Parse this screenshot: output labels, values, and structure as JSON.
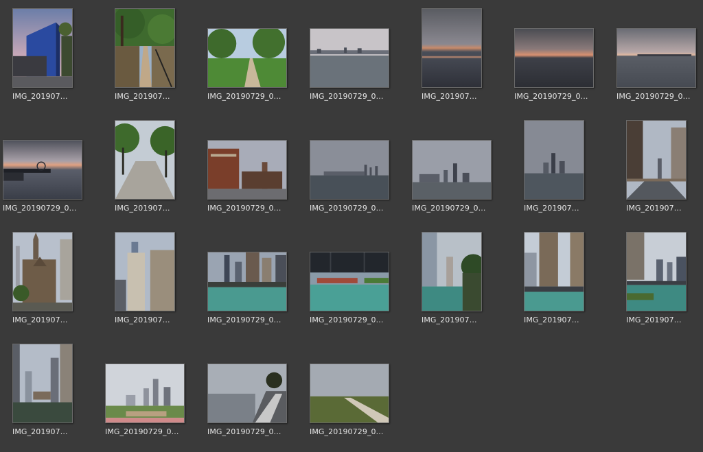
{
  "window": {
    "background": "#3a3a3a",
    "label_color": "#e6e6e6"
  },
  "files": [
    {
      "label": "IMG_201907...",
      "scene": "skyscraper-dusk"
    },
    {
      "label": "IMG_201907...",
      "scene": "tree-lined-path"
    },
    {
      "label": "IMG_20190729_0...",
      "scene": "park-path"
    },
    {
      "label": "IMG_20190729_0...",
      "scene": "lake-skyline"
    },
    {
      "label": "IMG_201907...",
      "scene": "lake-sunset-portrait"
    },
    {
      "label": "IMG_20190729_0...",
      "scene": "lake-sunset"
    },
    {
      "label": "IMG_20190729_0...",
      "scene": "lake-horizon"
    },
    {
      "label": "IMG_20190729_0...",
      "scene": "pier-sunset"
    },
    {
      "label": "IMG_201907...",
      "scene": "tree-promenade"
    },
    {
      "label": "IMG_20190729_0...",
      "scene": "brick-buildings"
    },
    {
      "label": "IMG_20190729_0...",
      "scene": "lake-skyline-cloudy"
    },
    {
      "label": "IMG_20190729_0...",
      "scene": "skyline-cloudy"
    },
    {
      "label": "IMG_201907...",
      "scene": "skyline-water-portrait"
    },
    {
      "label": "IMG_201907...",
      "scene": "city-street"
    },
    {
      "label": "IMG_201907...",
      "scene": "gothic-church"
    },
    {
      "label": "IMG_201907...",
      "scene": "tower-buildings"
    },
    {
      "label": "IMG_20190729_0...",
      "scene": "river-towers"
    },
    {
      "label": "IMG_20190729_0...",
      "scene": "river-bridge"
    },
    {
      "label": "IMG_201907...",
      "scene": "riverwalk"
    },
    {
      "label": "IMG_201907...",
      "scene": "marina-towers"
    },
    {
      "label": "IMG_201907...",
      "scene": "river-skyscrapers"
    },
    {
      "label": "IMG_201907...",
      "scene": "river-canyon"
    },
    {
      "label": "IMG_20190729_0...",
      "scene": "skyline-park"
    },
    {
      "label": "IMG_20190729_0...",
      "scene": "shoreline-wall"
    },
    {
      "label": "IMG_20190729_0...",
      "scene": "grassy-path"
    }
  ]
}
